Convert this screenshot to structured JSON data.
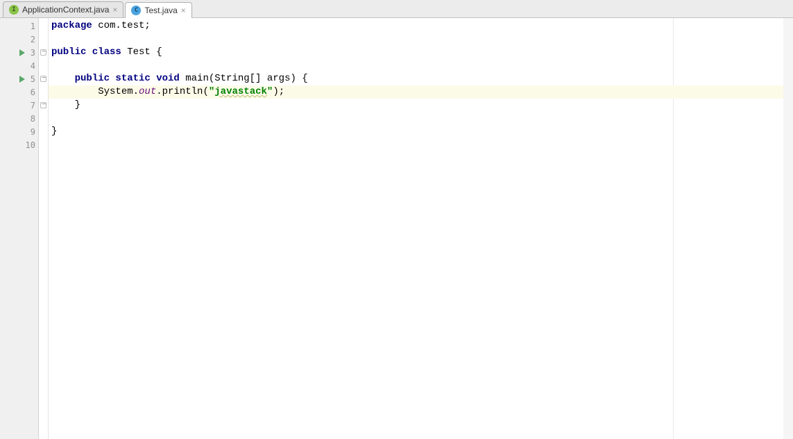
{
  "tabs": [
    {
      "label": "ApplicationContext.java",
      "iconType": "interface",
      "active": false
    },
    {
      "label": "Test.java",
      "iconType": "class",
      "active": true
    }
  ],
  "lines": {
    "l1": {
      "num": "1",
      "indent": "",
      "tokens": [
        [
          "kw",
          "package"
        ],
        [
          "plain",
          " com.test;"
        ]
      ]
    },
    "l2": {
      "num": "2",
      "indent": "",
      "tokens": []
    },
    "l3": {
      "num": "3",
      "indent": "",
      "tokens": [
        [
          "kw",
          "public class"
        ],
        [
          "plain",
          " Test {"
        ]
      ],
      "run": true,
      "fold": true
    },
    "l4": {
      "num": "4",
      "indent": "",
      "tokens": []
    },
    "l5": {
      "num": "5",
      "indent": "    ",
      "tokens": [
        [
          "kw",
          "public static void"
        ],
        [
          "plain",
          " main(String[] args) {"
        ]
      ],
      "run": true,
      "fold": true
    },
    "l6": {
      "num": "6",
      "indent": "        ",
      "tokens": [
        [
          "plain",
          "System."
        ],
        [
          "static-field",
          "out"
        ],
        [
          "plain",
          ".println("
        ],
        [
          "str",
          "\"javastack\""
        ],
        [
          "plain",
          ");"
        ]
      ],
      "highlight": true
    },
    "l7": {
      "num": "7",
      "indent": "    ",
      "tokens": [
        [
          "plain",
          "}"
        ]
      ],
      "fold": true
    },
    "l8": {
      "num": "8",
      "indent": "",
      "tokens": []
    },
    "l9": {
      "num": "9",
      "indent": "",
      "tokens": [
        [
          "plain",
          "}"
        ]
      ]
    },
    "l10": {
      "num": "10",
      "indent": "",
      "tokens": []
    }
  },
  "lineOrder": [
    "l1",
    "l2",
    "l3",
    "l4",
    "l5",
    "l6",
    "l7",
    "l8",
    "l9",
    "l10"
  ]
}
